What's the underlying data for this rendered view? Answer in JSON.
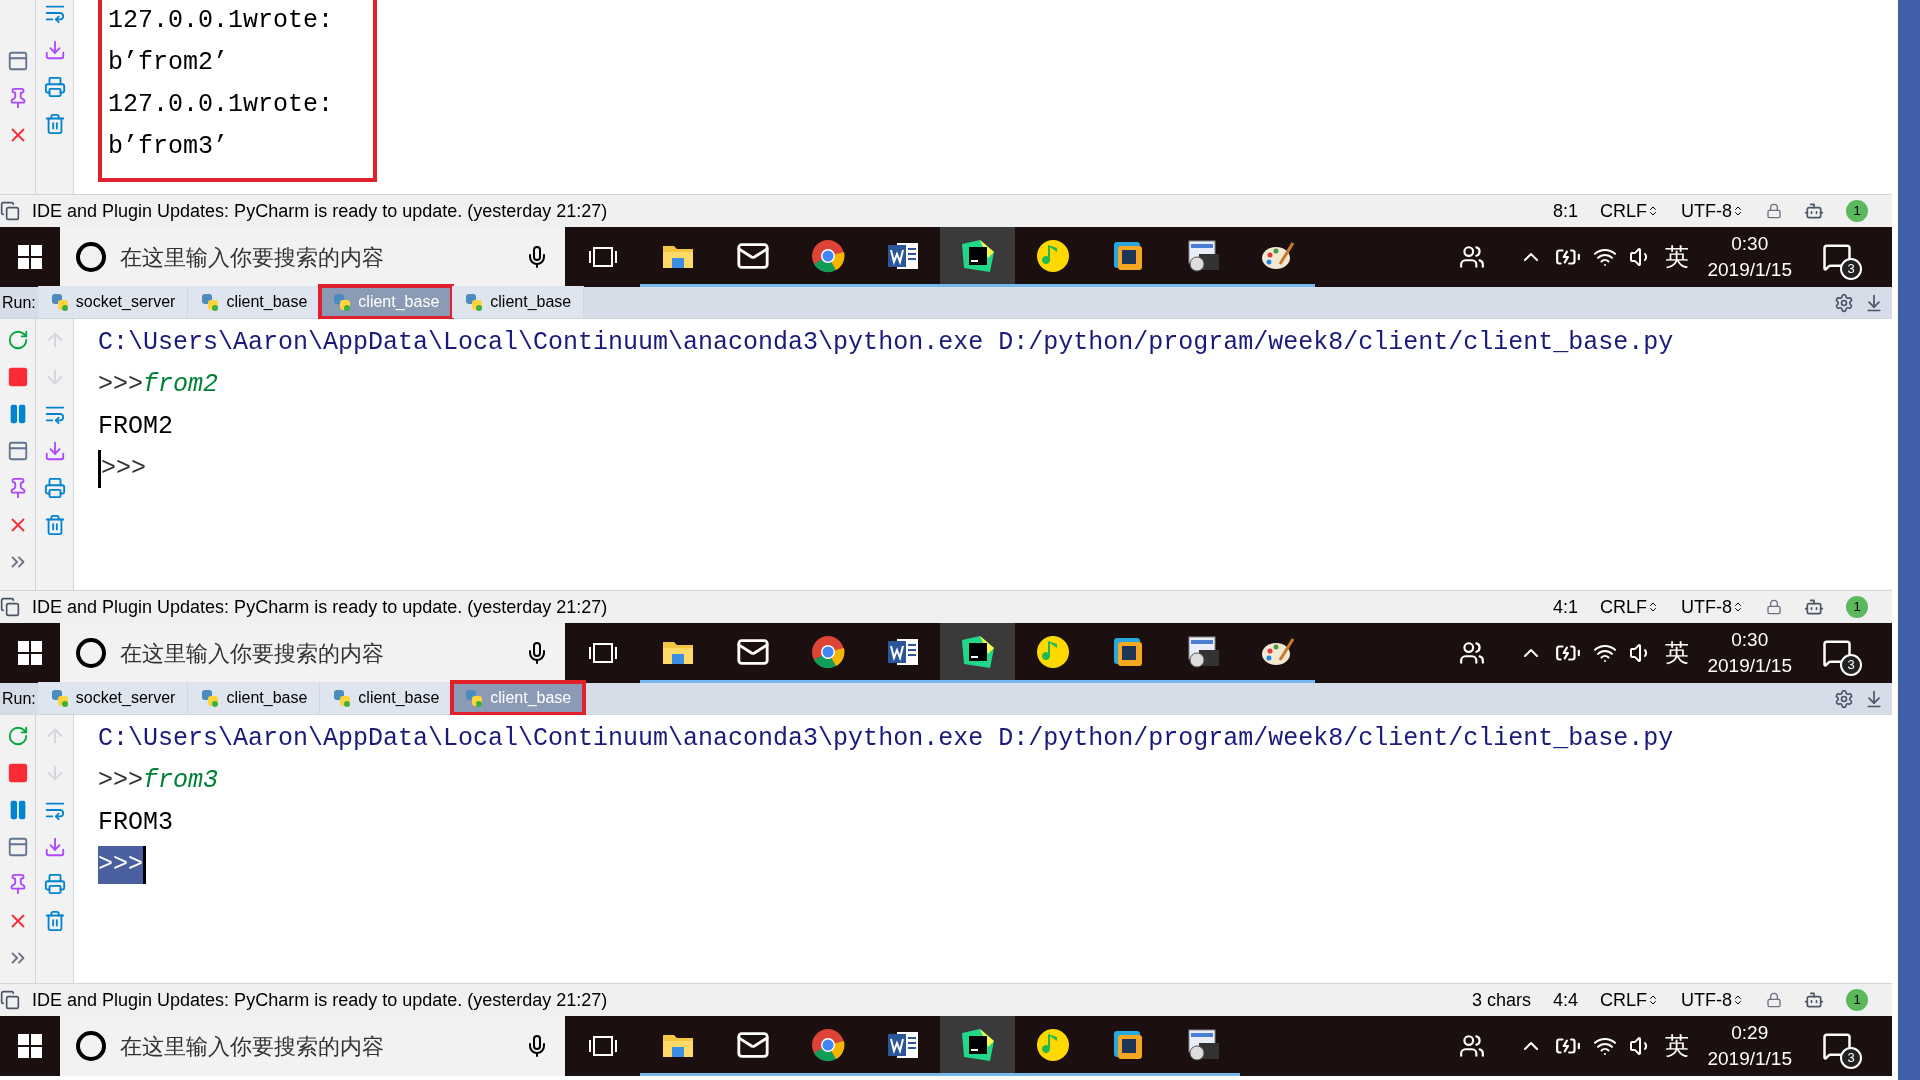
{
  "panels": [
    {
      "console": {
        "highlighted": true,
        "lines": [
          {
            "kind": "output",
            "text": "127.0.0.1wrote:"
          },
          {
            "kind": "output",
            "text": "b’from2’"
          },
          {
            "kind": "output",
            "text": "127.0.0.1wrote:"
          },
          {
            "kind": "output",
            "text": "b’from3’"
          }
        ]
      },
      "status": {
        "message": "IDE and Plugin Updates: PyCharm is ready to update. (yesterday 21:27)",
        "fields": [
          "8:1"
        ],
        "line_separator": "CRLF",
        "encoding": "UTF-8",
        "notifications": "1"
      },
      "taskbar": {
        "search_placeholder": "在这里输入你要搜索的内容",
        "apps": [
          {
            "kind": "explorer",
            "active": false
          },
          {
            "kind": "mail",
            "active": false
          },
          {
            "kind": "chrome",
            "active": false
          },
          {
            "kind": "word",
            "active": false
          },
          {
            "kind": "pycharm",
            "active": true
          },
          {
            "kind": "music",
            "active": false
          },
          {
            "kind": "vm",
            "active": false
          },
          {
            "kind": "remote",
            "active": false
          },
          {
            "kind": "paint",
            "active": false
          }
        ],
        "ime": "英",
        "time": "0:30",
        "date": "2019/1/15",
        "notifications": "3"
      }
    },
    {
      "run_label": "Run:",
      "tabs": [
        {
          "label": "socket_server",
          "selected": false,
          "highlighted": false
        },
        {
          "label": "client_base",
          "selected": false,
          "highlighted": false
        },
        {
          "label": "client_base",
          "selected": true,
          "highlighted": true
        },
        {
          "label": "client_base",
          "selected": false,
          "highlighted": false
        }
      ],
      "console": {
        "highlighted": false,
        "lines": [
          {
            "kind": "command",
            "text": "C:\\Users\\Aaron\\AppData\\Local\\Continuum\\anaconda3\\python.exe D:/python/program/week8/client/client_base.py"
          },
          {
            "kind": "input",
            "prompt": ">>>",
            "text": "from2"
          },
          {
            "kind": "output",
            "text": "FROM2"
          },
          {
            "kind": "prompt",
            "text": ">>>",
            "selected": false
          }
        ]
      },
      "status": {
        "message": "IDE and Plugin Updates: PyCharm is ready to update. (yesterday 21:27)",
        "fields": [
          "4:1"
        ],
        "line_separator": "CRLF",
        "encoding": "UTF-8",
        "notifications": "1"
      },
      "taskbar": {
        "search_placeholder": "在这里输入你要搜索的内容",
        "apps": [
          {
            "kind": "explorer",
            "active": false
          },
          {
            "kind": "mail",
            "active": false
          },
          {
            "kind": "chrome",
            "active": false
          },
          {
            "kind": "word",
            "active": false
          },
          {
            "kind": "pycharm",
            "active": true
          },
          {
            "kind": "music",
            "active": false
          },
          {
            "kind": "vm",
            "active": false
          },
          {
            "kind": "remote",
            "active": false
          },
          {
            "kind": "paint",
            "active": false
          }
        ],
        "ime": "英",
        "time": "0:30",
        "date": "2019/1/15",
        "notifications": "3"
      }
    },
    {
      "run_label": "Run:",
      "tabs": [
        {
          "label": "socket_server",
          "selected": false,
          "highlighted": false
        },
        {
          "label": "client_base",
          "selected": false,
          "highlighted": false
        },
        {
          "label": "client_base",
          "selected": false,
          "highlighted": false
        },
        {
          "label": "client_base",
          "selected": true,
          "highlighted": true
        }
      ],
      "console": {
        "highlighted": false,
        "lines": [
          {
            "kind": "command",
            "text": "C:\\Users\\Aaron\\AppData\\Local\\Continuum\\anaconda3\\python.exe D:/python/program/week8/client/client_base.py"
          },
          {
            "kind": "input",
            "prompt": ">>>",
            "text": "from3"
          },
          {
            "kind": "output",
            "text": "FROM3"
          },
          {
            "kind": "prompt",
            "text": ">>>",
            "selected": true
          }
        ]
      },
      "status": {
        "message": "IDE and Plugin Updates: PyCharm is ready to update. (yesterday 21:27)",
        "fields": [
          "3 chars",
          "4:4"
        ],
        "line_separator": "CRLF",
        "encoding": "UTF-8",
        "notifications": "1"
      },
      "taskbar": {
        "search_placeholder": "在这里输入你要搜索的内容",
        "apps": [
          {
            "kind": "explorer",
            "active": false
          },
          {
            "kind": "mail",
            "active": false
          },
          {
            "kind": "chrome",
            "active": false
          },
          {
            "kind": "word",
            "active": false
          },
          {
            "kind": "pycharm",
            "active": true
          },
          {
            "kind": "music",
            "active": false
          },
          {
            "kind": "vm",
            "active": false
          },
          {
            "kind": "remote",
            "active": false
          }
        ],
        "ime": "英",
        "time": "0:29",
        "date": "2019/1/15",
        "notifications": "3"
      }
    }
  ]
}
